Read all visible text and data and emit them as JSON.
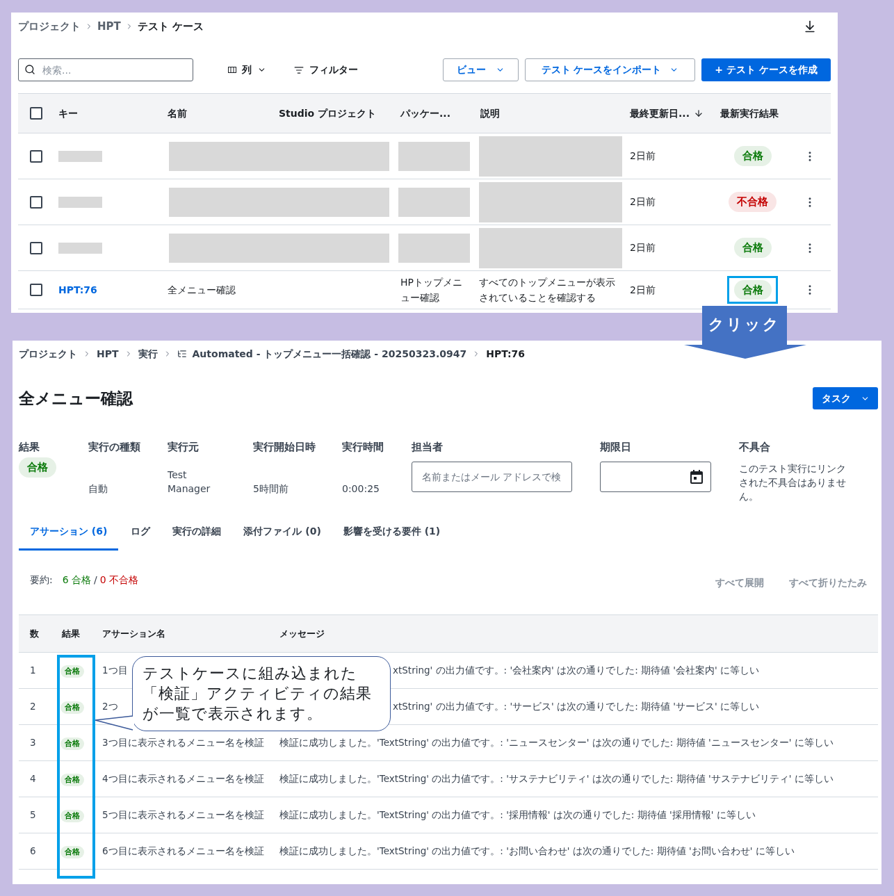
{
  "test_case_list": {
    "breadcrumb": [
      {
        "label": "プロジェクト",
        "current": false
      },
      {
        "label": "HPT",
        "current": false
      },
      {
        "label": "テスト ケース",
        "current": true
      }
    ],
    "search": {
      "placeholder": "検索..."
    },
    "toolbar": {
      "columns_button": "列",
      "filter_button": "フィルター",
      "view_button": "ビュー",
      "import_button": "テスト ケースをインポート",
      "create_button": "+ テスト ケースを作成"
    },
    "table": {
      "select_all_checked": false,
      "columns": [
        "キー",
        "名前",
        "Studio プロジェクト",
        "パッケー...",
        "説明",
        "最終更新日...",
        "最新実行結果"
      ],
      "rows": [
        {
          "kind": "redacted",
          "checked": false,
          "updated": "2日前",
          "result": {
            "label": "合格",
            "color": "#0b7a0b"
          },
          "highlighted": false
        },
        {
          "kind": "redacted",
          "checked": false,
          "updated": "2日前",
          "result": {
            "label": "不合格",
            "color": "#c40000"
          },
          "highlighted": false
        },
        {
          "kind": "redacted",
          "checked": false,
          "updated": "2日前",
          "result": {
            "label": "合格",
            "color": "#0b7a0b"
          },
          "highlighted": false
        },
        {
          "kind": "item",
          "checked": false,
          "key": "HPT:76",
          "name": "全メニュー確認",
          "package": "HPトップメニュー確認",
          "description": "すべてのトップメニューが表示されていることを確認する",
          "updated": "2日前",
          "result": {
            "label": "合格",
            "color": "#0b7a0b"
          },
          "highlighted": true
        }
      ]
    }
  },
  "click_arrow": {
    "label": "クリック"
  },
  "test_run_detail": {
    "breadcrumb": [
      {
        "label": "プロジェクト",
        "current": false,
        "kind": "text"
      },
      {
        "label": "HPT",
        "current": false,
        "kind": "text"
      },
      {
        "label": "実行",
        "current": false,
        "kind": "text"
      },
      {
        "label": "Automated - トップメニュー一括確認 - 20250323.0947",
        "current": false,
        "kind": "run"
      },
      {
        "label": "HPT:76",
        "current": true,
        "kind": "text"
      }
    ],
    "title": "全メニュー確認",
    "task_button": "タスク",
    "fields": [
      {
        "kind": "badge",
        "label": "結果",
        "value": "合格",
        "color": "#0b7a0b"
      },
      {
        "kind": "text",
        "label": "実行の種類",
        "value": "自動"
      },
      {
        "kind": "text",
        "label": "実行元",
        "value": "Test Manager"
      },
      {
        "kind": "text",
        "label": "実行開始日時",
        "value": "5時間前"
      },
      {
        "kind": "text",
        "label": "実行時間",
        "value": "0:00:25"
      },
      {
        "kind": "person_input",
        "label": "担当者",
        "placeholder": "名前またはメール アドレスで検"
      },
      {
        "kind": "date_input",
        "label": "期限日"
      },
      {
        "kind": "note",
        "label": "不具合",
        "value": "このテスト実行にリンクされた不具合はありません。"
      }
    ],
    "tabs": [
      {
        "label": "アサーション (6)",
        "selected": true
      },
      {
        "label": "ログ",
        "selected": false
      },
      {
        "label": "実行の詳細",
        "selected": false
      },
      {
        "label": "添付ファイル (0)",
        "selected": false
      },
      {
        "label": "影響を受ける要件 (1)",
        "selected": false
      }
    ],
    "summary": {
      "label": "要約:",
      "passed": "6 合格",
      "separator": "/",
      "failed": "0 不合格"
    },
    "expand_all": "すべて展開",
    "collapse_all": "すべて折りたたみ",
    "assertions": {
      "columns": [
        "数",
        "結果",
        "アサーション名",
        "メッセージ"
      ],
      "rows": [
        {
          "number": "1",
          "result": {
            "label": "合格",
            "color": "#0b7a0b"
          },
          "name": "1つ目",
          "message": "xtString' の出力値です。: '会社案内' は次の通りでした: 期待値 '会社案内' に等しい",
          "partly_hidden": true
        },
        {
          "number": "2",
          "result": {
            "label": "合格",
            "color": "#0b7a0b"
          },
          "name": "2つ",
          "message": "xtString' の出力値です。: 'サービス' は次の通りでした: 期待値 'サービス' に等しい",
          "partly_hidden": true
        },
        {
          "number": "3",
          "result": {
            "label": "合格",
            "color": "#0b7a0b"
          },
          "name": "3つ目に表示されるメニュー名を検証",
          "message": "検証に成功しました。'TextString' の出力値です。: 'ニュースセンター' は次の通りでした: 期待値 'ニュースセンター' に等しい",
          "partly_hidden": false
        },
        {
          "number": "4",
          "result": {
            "label": "合格",
            "color": "#0b7a0b"
          },
          "name": "4つ目に表示されるメニュー名を検証",
          "message": "検証に成功しました。'TextString' の出力値です。: 'サステナビリティ' は次の通りでした: 期待値 'サステナビリティ' に等しい",
          "partly_hidden": false
        },
        {
          "number": "5",
          "result": {
            "label": "合格",
            "color": "#0b7a0b"
          },
          "name": "5つ目に表示されるメニュー名を検証",
          "message": "検証に成功しました。'TextString' の出力値です。: '採用情報' は次の通りでした: 期待値 '採用情報' に等しい",
          "partly_hidden": false
        },
        {
          "number": "6",
          "result": {
            "label": "合格",
            "color": "#0b7a0b"
          },
          "name": "6つ目に表示されるメニュー名を検証",
          "message": "検証に成功しました。'TextString' の出力値です。: 'お問い合わせ' は次の通りでした: 期待値 'お問い合わせ' に等しい",
          "partly_hidden": false
        }
      ]
    },
    "result_column_highlighted": true
  },
  "callout": {
    "text": "テストケースに組み込まれた「検証」アクティビティの結果が一覧で表示されます。"
  }
}
